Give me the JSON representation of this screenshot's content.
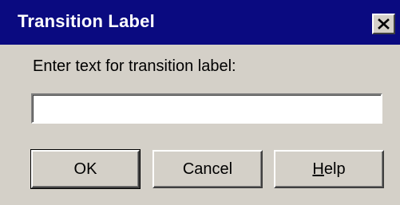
{
  "window": {
    "title": "Transition Label",
    "close_label": "close"
  },
  "dialog": {
    "prompt": "Enter text for transition label:",
    "input_value": "",
    "input_placeholder": ""
  },
  "buttons": {
    "ok_label": "OK",
    "cancel_label": "Cancel",
    "help_label": "Help"
  },
  "icons": {
    "close": "close-icon"
  },
  "colors": {
    "titlebar": "#0a0a80",
    "title_text": "#ffffff",
    "dialog_background": "#d4d0c8",
    "field_background": "#ffffff"
  }
}
